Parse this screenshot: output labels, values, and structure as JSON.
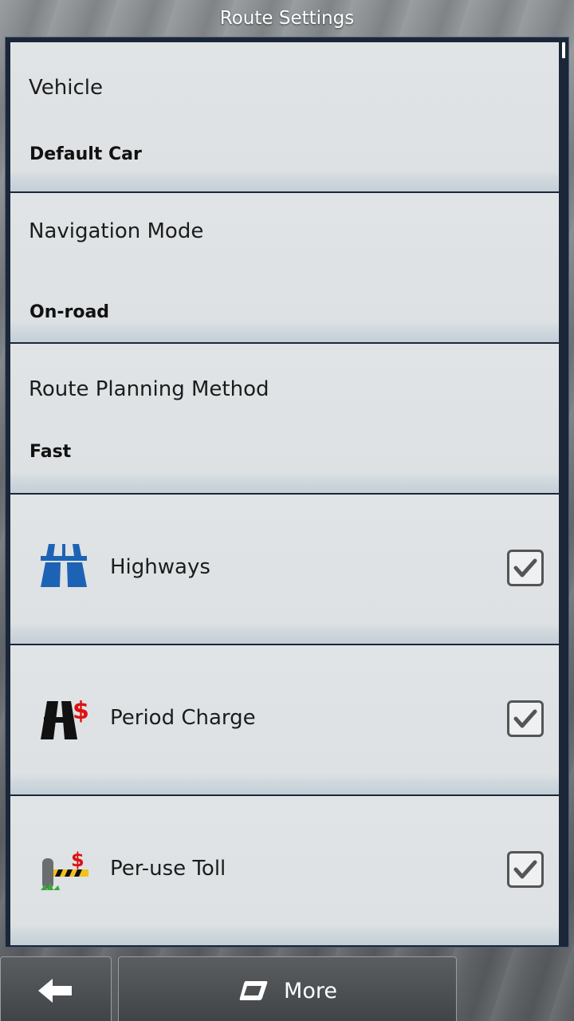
{
  "header": {
    "title": "Route Settings"
  },
  "settings": [
    {
      "title": "Vehicle",
      "value": "Default Car"
    },
    {
      "title": "Navigation Mode",
      "value": "On-road"
    },
    {
      "title": "Route Planning Method",
      "value": "Fast"
    }
  ],
  "toggles": [
    {
      "label": "Highways",
      "icon": "highway-icon",
      "checked": true
    },
    {
      "label": "Period Charge",
      "icon": "period-charge-icon",
      "checked": true
    },
    {
      "label": "Per-use Toll",
      "icon": "toll-barrier-icon",
      "checked": true
    }
  ],
  "footer": {
    "back_icon": "back-arrow-icon",
    "more_icon": "more-icon",
    "more_label": "More"
  },
  "colors": {
    "list_background": "#dde1e3",
    "frame_border": "#1b2738",
    "highway_blue": "#1d63b5",
    "dollar_red": "#e01010"
  }
}
